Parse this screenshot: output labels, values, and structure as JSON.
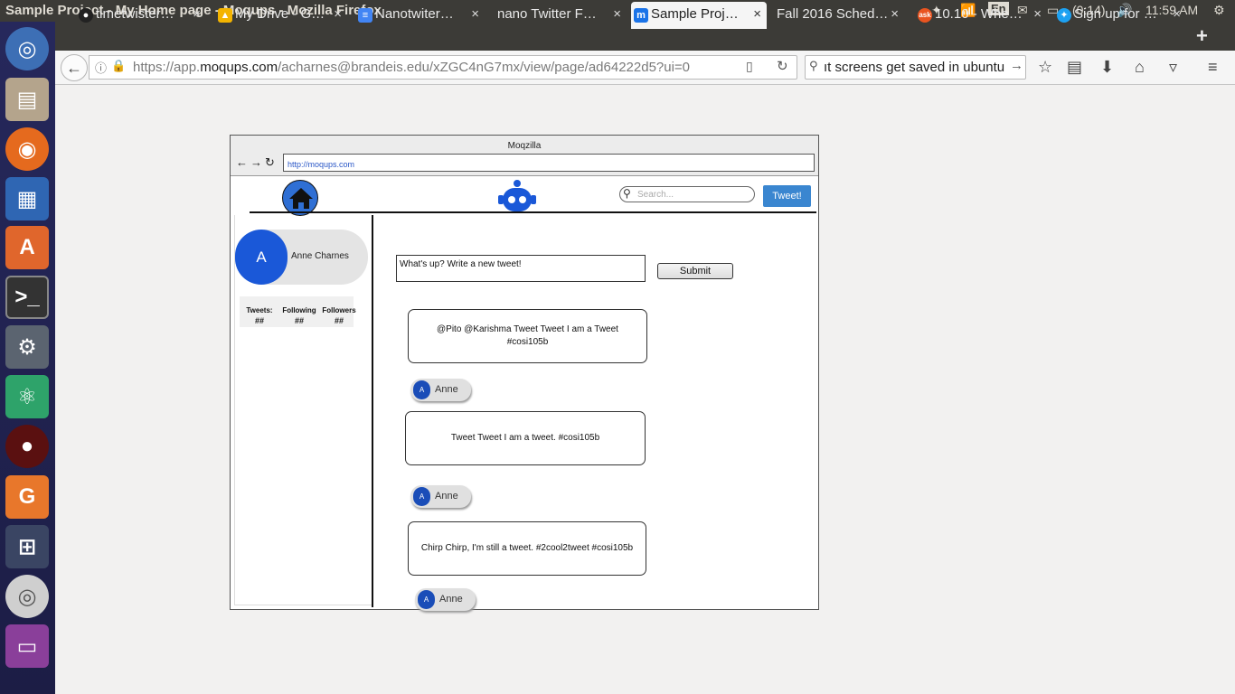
{
  "system": {
    "window_title": "Sample Project - My Home page - Moqups - Mozilla Firefox",
    "keyboard_layout": "En",
    "battery": "(0:14)",
    "clock": "11:59 AM"
  },
  "browser": {
    "tabs": [
      {
        "label": "timetwister…",
        "favicon": "github-icon",
        "active": false
      },
      {
        "label": "My Drive - G…",
        "favicon": "drive-icon",
        "active": false
      },
      {
        "label": "Nanotwiter…",
        "favicon": "docs-icon",
        "active": false
      },
      {
        "label": "nano Twitter F…",
        "favicon": "",
        "active": false
      },
      {
        "label": "Sample Proj…",
        "favicon": "moqups-icon",
        "active": true
      },
      {
        "label": "Fall 2016 Sched…",
        "favicon": "",
        "active": false
      },
      {
        "label": "10.10 - Whe…",
        "favicon": "askubuntu-icon",
        "active": false
      },
      {
        "label": "Sign up for …",
        "favicon": "twitter-icon",
        "active": false
      }
    ],
    "url_prefix": "https://app.",
    "url_domain": "moqups.com",
    "url_rest": "/acharnes@brandeis.edu/xZGC4nG7mx/view/page/ad64222d5?ui=0",
    "search_text": "ıt screens get saved in ubuntu"
  },
  "mockup": {
    "window_title": "Moqzilla",
    "address": "http://moqups.com",
    "search_placeholder": "Search...",
    "tweet_button": "Tweet!",
    "profile": {
      "initial": "A",
      "name": "Anne Charnes"
    },
    "stats": [
      {
        "label": "Tweets:",
        "value": "##"
      },
      {
        "label": "Following",
        "value": "##"
      },
      {
        "label": "Followers",
        "value": "##"
      }
    ],
    "compose_placeholder": "What's up? Write a new tweet!",
    "submit_label": "Submit",
    "tweets": [
      {
        "text": "@Pito @Karishma Tweet Tweet I am a Tweet #cosi105b",
        "author": "Anne",
        "initial": "A"
      },
      {
        "text": "Tweet Tweet I am a tweet. #cosi105b",
        "author": "Anne",
        "initial": "A"
      },
      {
        "text": "Chirp Chirp, I'm still a tweet. #2cool2tweet #cosi105b",
        "author": "Anne",
        "initial": "A"
      }
    ]
  },
  "colors": {
    "accent_blue": "#3a86d0",
    "avatar_blue": "#1a58d8",
    "link_blue": "#2a57c7"
  }
}
